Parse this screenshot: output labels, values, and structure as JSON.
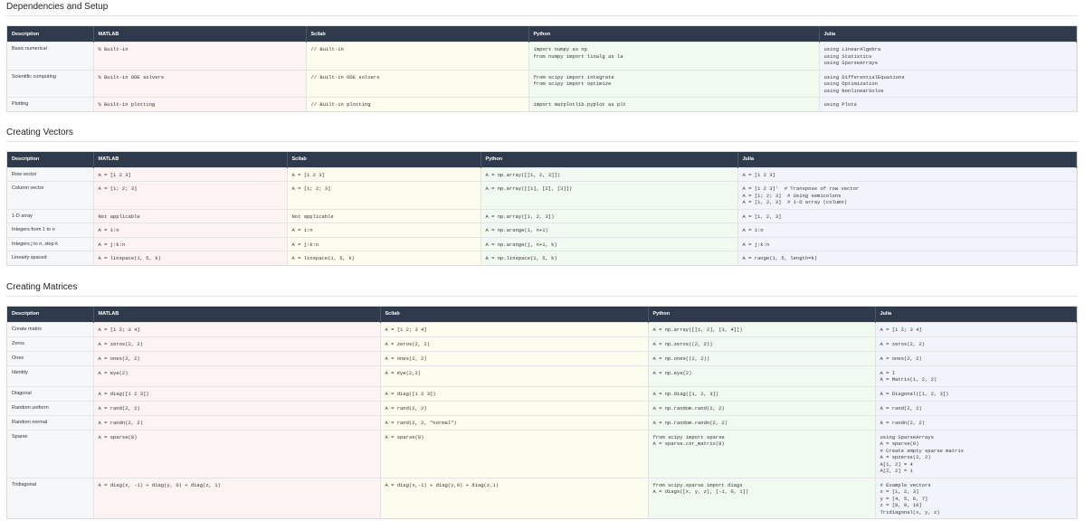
{
  "sections": [
    {
      "title": "Dependencies and Setup",
      "headers": [
        "Description",
        "MATLAB",
        "Scilab",
        "Python",
        "Julia"
      ],
      "rows": [
        [
          "Basic numerical",
          "% Built-in",
          "// Built-in",
          "import numpy as np\nfrom numpy import linalg as la",
          "using LinearAlgebra\nusing Statistics\nusing SparseArrays"
        ],
        [
          "Scientific computing",
          "% Built-in ODE solvers",
          "// Built-in ODE solvers",
          "from scipy import integrate\nfrom scipy import optimize",
          "using DifferentialEquations\nusing Optimization\nusing NonlinearSolve"
        ],
        [
          "Plotting",
          "% Built-in plotting",
          "// Built-in plotting",
          "import matplotlib.pyplot as plt",
          "using Plots"
        ]
      ]
    },
    {
      "title": "Creating Vectors",
      "headers": [
        "Description",
        "MATLAB",
        "Scilab",
        "Python",
        "Julia"
      ],
      "rows": [
        [
          "Row vector",
          "A = [1 2 3]",
          "A = [1 2 3]",
          "A = np.array([[1, 2, 3]])",
          "A = [1 2 3]"
        ],
        [
          "Column vector",
          "A = [1; 2; 3]",
          "A = [1; 2; 3]",
          "A = np.array([[1], [2], [3]])",
          "A = [1 2 3]'  # Transpose of row vector\nA = [1; 2; 3]  # Using semicolons\nA = [1, 2, 3]  # 1-D array (column)"
        ],
        [
          "1-D array",
          "Not applicable",
          "Not applicable",
          "A = np.array([1, 2, 3])",
          "A = [1, 2, 3]"
        ],
        [
          "Integers from 1 to n",
          "A = 1:n",
          "A = 1:n",
          "A = np.arange(1, n+1)",
          "A = 1:n"
        ],
        [
          "Integers j to n, step k",
          "A = j:k:n",
          "A = j:k:n",
          "A = np.arange(j, n+1, k)",
          "A = j:k:n"
        ],
        [
          "Linearly spaced",
          "A = linspace(1, 5, k)",
          "A = linspace(1, 5, k)",
          "A = np.linspace(1, 5, k)",
          "A = range(1, 5, length=k)"
        ]
      ]
    },
    {
      "title": "Creating Matrices",
      "headers": [
        "Description",
        "MATLAB",
        "Scilab",
        "Python",
        "Julia"
      ],
      "rows": [
        [
          "Create matrix",
          "A = [1 2; 3 4]",
          "A = [1 2; 3 4]",
          "A = np.array([[1, 2], [3, 4]])",
          "A = [1 2; 3 4]"
        ],
        [
          "Zeros",
          "A = zeros(2, 2)",
          "A = zeros(2, 2)",
          "A = np.zeros((2, 2))",
          "A = zeros(2, 2)"
        ],
        [
          "Ones",
          "A = ones(2, 2)",
          "A = ones(2, 2)",
          "A = np.ones((2, 2))",
          "A = ones(2, 2)"
        ],
        [
          "Identity",
          "A = eye(2)",
          "A = eye(2,2)",
          "A = np.eye(2)",
          "A = I\nA = Matrix(1, 2, 2)"
        ],
        [
          "Diagonal",
          "A = diag([1 2 3])",
          "A = diag([1 2 3])",
          "A = np.diag([1, 2, 3])",
          "A = Diagonal([1, 2, 3])"
        ],
        [
          "Random uniform",
          "A = rand(2, 2)",
          "A = rand(2, 2)",
          "A = np.random.rand(2, 2)",
          "A = rand(2, 2)"
        ],
        [
          "Random normal",
          "A = randn(2, 2)",
          "A = rand(2, 2, \"normal\")",
          "A = np.random.randn(2, 2)",
          "A = randn(2, 2)"
        ],
        [
          "Sparse",
          "A = sparse(8)",
          "A = sparse(8)",
          "from scipy import sparse\nA = sparse.csr_matrix(8)",
          "using SparseArrays\nA = sparse(8)\n# Create empty sparse matrix\nA = spzeros(2, 2)\nA[1, 2] = 4\nA[2, 2] = 1"
        ],
        [
          "Tridiagonal",
          "A = diag(x, -1) + diag(y, 0) + diag(z, 1)",
          "A = diag(x,-1) + diag(y,0) + diag(z,1)",
          "from scipy.sparse import diags\nA = diags([x, y, z], [-1, 0, 1])",
          "# Example vectors\nx = [1, 2, 3]\ny = [4, 5, 6, 7]\nz = [8, 9, 10]\nTridiagonal(x, y, z)"
        ]
      ]
    }
  ]
}
